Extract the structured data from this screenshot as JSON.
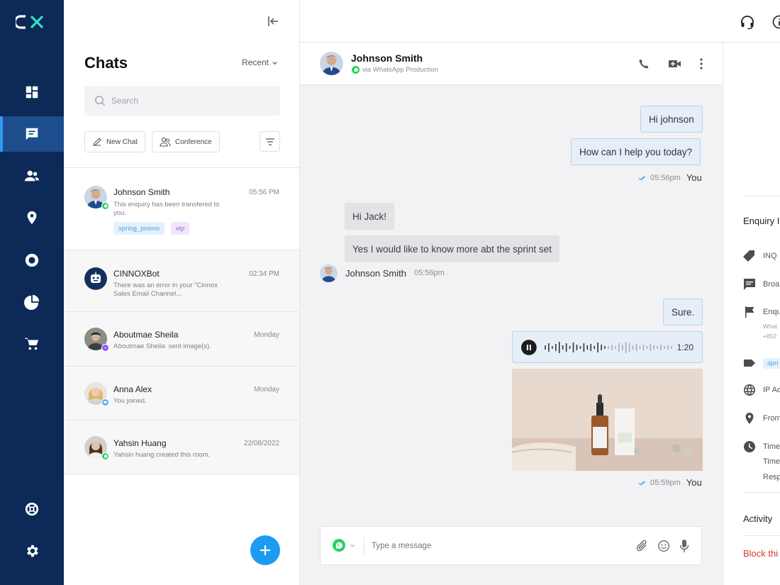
{
  "brand": {
    "logo_text": "CX",
    "rail_color": "#0c2957",
    "accent": "#1c9bf0"
  },
  "nav": [
    {
      "icon": "dashboard-icon",
      "active": false
    },
    {
      "icon": "chat-icon",
      "active": true
    },
    {
      "icon": "contacts-icon",
      "active": false
    },
    {
      "icon": "location-icon",
      "active": false
    },
    {
      "icon": "circle-icon",
      "active": false
    },
    {
      "icon": "pie-chart-icon",
      "active": false
    },
    {
      "icon": "cart-icon",
      "active": false
    },
    {
      "icon": "help-icon",
      "active": false
    },
    {
      "icon": "settings-icon",
      "active": false
    }
  ],
  "chats_panel": {
    "title": "Chats",
    "sort_label": "Recent",
    "search_placeholder": "Search",
    "new_chat_label": "New Chat",
    "conference_label": "Conference",
    "items": [
      {
        "name": "Johnson Smith",
        "time": "05:56 PM",
        "preview": "This enquiry has been transfered to you.",
        "tags": [
          "spring_promo",
          "vip"
        ],
        "channel": "whatsapp"
      },
      {
        "name": "CINNOXBot",
        "time": "02:34 PM",
        "preview": "There was an error in your \"Cinnox Sales Email Channel...",
        "tags": [],
        "channel": "bot"
      },
      {
        "name": "Aboutmae Sheila",
        "time": "Monday",
        "preview": "Aboutmae Sheila: sent image(s).",
        "tags": [],
        "channel": "messenger"
      },
      {
        "name": "Anna Alex",
        "time": "Monday",
        "preview": "You joined.",
        "tags": [],
        "channel": "web"
      },
      {
        "name": "Yahsin Huang",
        "time": "22/08/2022",
        "preview": "Yahsin huang created this room.",
        "tags": [],
        "channel": "whatsapp"
      }
    ]
  },
  "conversation": {
    "contact_name": "Johnson Smith",
    "via": "via WhatsApp Production",
    "messages": {
      "m1": "Hi johnson",
      "m2": "How can I help you today?",
      "m2_time": "05:56pm",
      "m2_sender": "You",
      "m3": "Hi Jack!",
      "m4": "Yes I would like to know more abt the sprint set",
      "m4_sender": "Johnson Smith",
      "m4_time": "05:56pm",
      "m5": "Sure.",
      "voice_duration": "1:20",
      "m7_time": "05:59pm",
      "m7_sender": "You"
    },
    "composer_placeholder": "Type a message"
  },
  "details_panel": {
    "section_title": "Enquiry I",
    "rows": [
      "INQ",
      "Broa",
      "Enqu",
      "What",
      "+852",
      "spri",
      "IP Ac",
      "From",
      "Time",
      "Time",
      "Resp"
    ],
    "activity_label": "Activity",
    "block_label": "Block thi"
  }
}
